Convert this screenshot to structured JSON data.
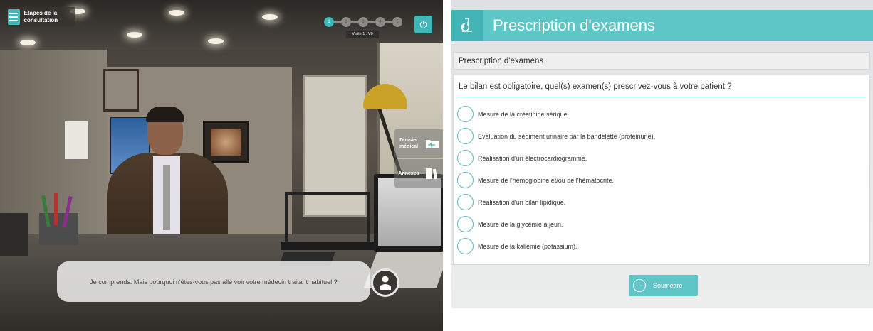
{
  "scene": {
    "menu_title": "Etapes de la consultation",
    "steps": [
      "1",
      "2",
      "3",
      "4",
      "5"
    ],
    "active_step": "1",
    "visit_label": "Visite 1 : V0",
    "side_buttons": {
      "dossier": "Dossier médical",
      "annexes": "Annexes"
    },
    "dialogue": "Je comprends. Mais pourquoi n'êtes-vous pas allé voir votre médecin traitant habituel ?",
    "accent_color": "#3eb8b8"
  },
  "panel": {
    "title": "Prescription d'examens",
    "section_title": "Prescription d'examens",
    "question": "Le bilan est obligatoire, quel(s) examen(s) prescrivez-vous à votre patient ?",
    "options": [
      "Mesure de la créatinine sérique.",
      "Evaluation du sédiment urinaire par la bandelette (protéinurie).",
      "Réalisation d'un électrocardiogramme.",
      "Mesure de l'hémoglobine et/ou de l'hématocrite.",
      "Réalisation d'un bilan lipidique.",
      "Mesure de la glycémie à jeun.",
      "Mesure de la kaliémie (potassium)."
    ],
    "submit_label": "Soumettre",
    "header_color": "#5fc6c8"
  }
}
